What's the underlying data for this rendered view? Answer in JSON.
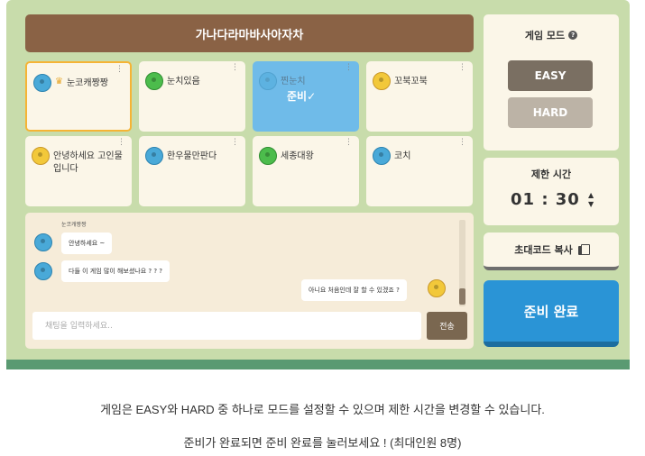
{
  "room": {
    "title": "가나다라마바사아자차"
  },
  "players": [
    {
      "name": "눈코캐짱짱",
      "avatar_color": "#49a9d8",
      "host": true,
      "me": true,
      "ready": false
    },
    {
      "name": "눈치있음",
      "avatar_color": "#4cbc4c",
      "host": false,
      "me": false,
      "ready": false
    },
    {
      "name": "찐눈치",
      "avatar_color": "#49a9d8",
      "host": false,
      "me": false,
      "ready": true,
      "ready_label": "준비✓"
    },
    {
      "name": "꼬북꼬북",
      "avatar_color": "#f2c83a",
      "host": false,
      "me": false,
      "ready": false
    },
    {
      "name": "안녕하세요 고인물입니다",
      "avatar_color": "#f2c83a",
      "host": false,
      "me": false,
      "ready": false
    },
    {
      "name": "한우물만판다",
      "avatar_color": "#49a9d8",
      "host": false,
      "me": false,
      "ready": false
    },
    {
      "name": "세종대왕",
      "avatar_color": "#4cbc4c",
      "host": false,
      "me": false,
      "ready": false
    },
    {
      "name": "코치",
      "avatar_color": "#49a9d8",
      "host": false,
      "me": false,
      "ready": false
    }
  ],
  "chat": {
    "sender_label": "눈코캐짱짱",
    "messages": [
      {
        "text": "안녕하세요 ~",
        "side": "left"
      },
      {
        "text": "다들 이 게임 많이 해보셨나요 ? ? ?",
        "side": "left"
      },
      {
        "text": "아니요 처음인데 잘 할 수 있겠죠 ?",
        "side": "right"
      }
    ],
    "input_placeholder": "채팅을 입력하세요..",
    "send_label": "전송"
  },
  "mode": {
    "title": "게임 모드",
    "help_icon": "?",
    "options": [
      "EASY",
      "HARD"
    ],
    "selected": "EASY"
  },
  "time_limit": {
    "title": "제한 시간",
    "value": "01 : 30",
    "up_icon": "▲",
    "down_icon": "▼"
  },
  "invite": {
    "label": "초대코드 복사"
  },
  "ready_button": {
    "label": "준비 완료"
  },
  "caption": {
    "line1": "게임은 EASY와 HARD 중 하나로 모드를 설정할 수 있으며  제한 시간을 변경할 수 있습니다.",
    "line2": "준비가 완료되면 준비 완료를 눌러보세요 ! (최대인원 8명)"
  },
  "colors": {
    "frame": "#c8dcab",
    "title_bar": "#8a6245",
    "host_border": "#f5b435",
    "ready_slot": "#6fbbe9",
    "ready_button": "#2a94d6"
  }
}
